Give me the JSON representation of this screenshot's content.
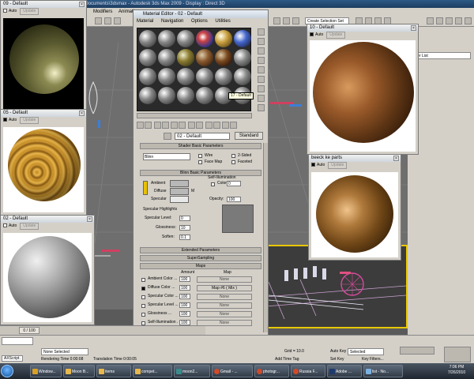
{
  "app": {
    "title": "ove\\Documents\\3dsmax   - Autodesk 3ds Max 2009   - Display : Direct 3D",
    "menu": [
      "Modifiers",
      "Animati"
    ],
    "selection_set": "Create Selection Set",
    "modifier_list": "ier List"
  },
  "material_editor": {
    "title": "Material Editor - 02 - Default",
    "menu": [
      "Material",
      "Navigation",
      "Options",
      "Utilities"
    ],
    "tooltip": "17 - Default",
    "material_name": "02 - Default",
    "type_button": "Standard",
    "shader_rollout": "Shader Basic Parameters",
    "shader_type": "Blinn",
    "shader_options": [
      "Wire",
      "2-Sided",
      "Face Map",
      "Faceted"
    ],
    "blinn_rollout": "Blinn Basic Parameters",
    "self_illum_label": "Self-Illumination",
    "self_illum_color_label": "Color",
    "self_illum_value": "0",
    "color_labels": [
      "Ambient",
      "Diffuse",
      "Specular"
    ],
    "diffuse_map_btn": "M",
    "opacity_label": "Opacity:",
    "opacity_value": "100",
    "spec_highlights_label": "Specular Highlights",
    "spec_level_label": "Specular Level:",
    "spec_level_value": "0",
    "glossiness_label": "Glossiness:",
    "glossiness_value": "10",
    "soften_label": "Soften:",
    "soften_value": "0.1",
    "extended_rollout": "Extended Parameters",
    "supersampling_rollout": "SuperSampling",
    "maps_rollout": "Maps",
    "maps_col_amount": "Amount",
    "maps_col_map": "Map",
    "maps": [
      {
        "label": "Ambient Color ...",
        "amount": "100",
        "map": "None"
      },
      {
        "label": "Diffuse Color ...",
        "amount": "100",
        "map": "Map #6  ( Mix )",
        "checked": true
      },
      {
        "label": "Specular Color ...",
        "amount": "100",
        "map": "None"
      },
      {
        "label": "Specular Level ...",
        "amount": "100",
        "map": "None"
      },
      {
        "label": "Glossiness ...",
        "amount": "100",
        "map": "None"
      },
      {
        "label": "Self-Illumination .",
        "amount": "100",
        "map": "None"
      }
    ]
  },
  "previews": {
    "auto_label": "Auto",
    "update_label": "Update",
    "win09": "09 - Default",
    "win05": "05 - Default",
    "win02": "02 - Default",
    "win10": "10 - Default",
    "winbeeck": "beeck ke parts"
  },
  "timeline": {
    "frame": "0 / 100"
  },
  "status": {
    "script_label": "AXScript.",
    "selection": "None Selected",
    "rendering": "Rendering Time  0:00:08",
    "translation": "Translation Time  0:00:05",
    "grid": "Grid = 10.0",
    "add_time_tag": "Add Time Tag",
    "auto_key": "Auto Key",
    "selected": "Selected",
    "set_key": "Set Key",
    "key_filters": "Key Filters..."
  },
  "taskbar": {
    "items": [
      "Window...",
      "Moon B...",
      "items",
      "compet...",
      "moon2...",
      "Gmail - ...",
      "photogr...",
      "Russia F...",
      "Adobe ...",
      "list - No..."
    ],
    "time": "7:06 PM",
    "date": "7/26/2010"
  }
}
